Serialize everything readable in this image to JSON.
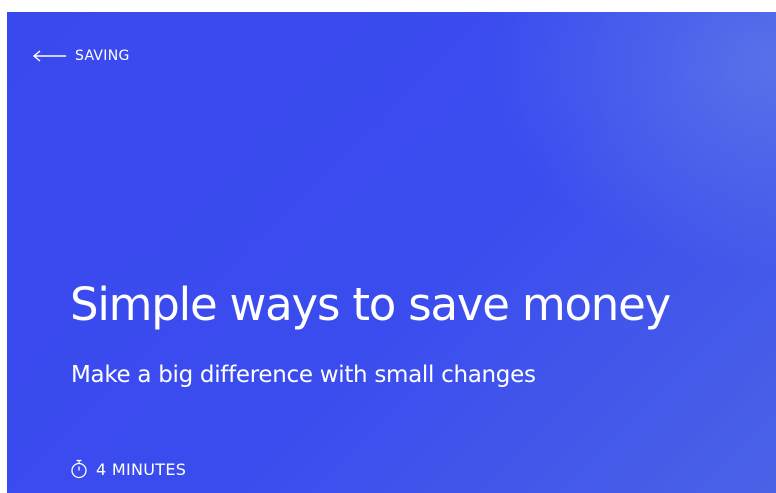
{
  "header": {
    "back_label": "SAVING",
    "back_icon": "arrow-left-icon"
  },
  "article": {
    "title": "Simple ways to save money",
    "subtitle": "Make a big difference with small changes",
    "read_time": "4 MINUTES",
    "read_time_icon": "stopwatch-icon"
  },
  "colors": {
    "hero_background": "#3b4cef",
    "text": "#ffffff"
  }
}
